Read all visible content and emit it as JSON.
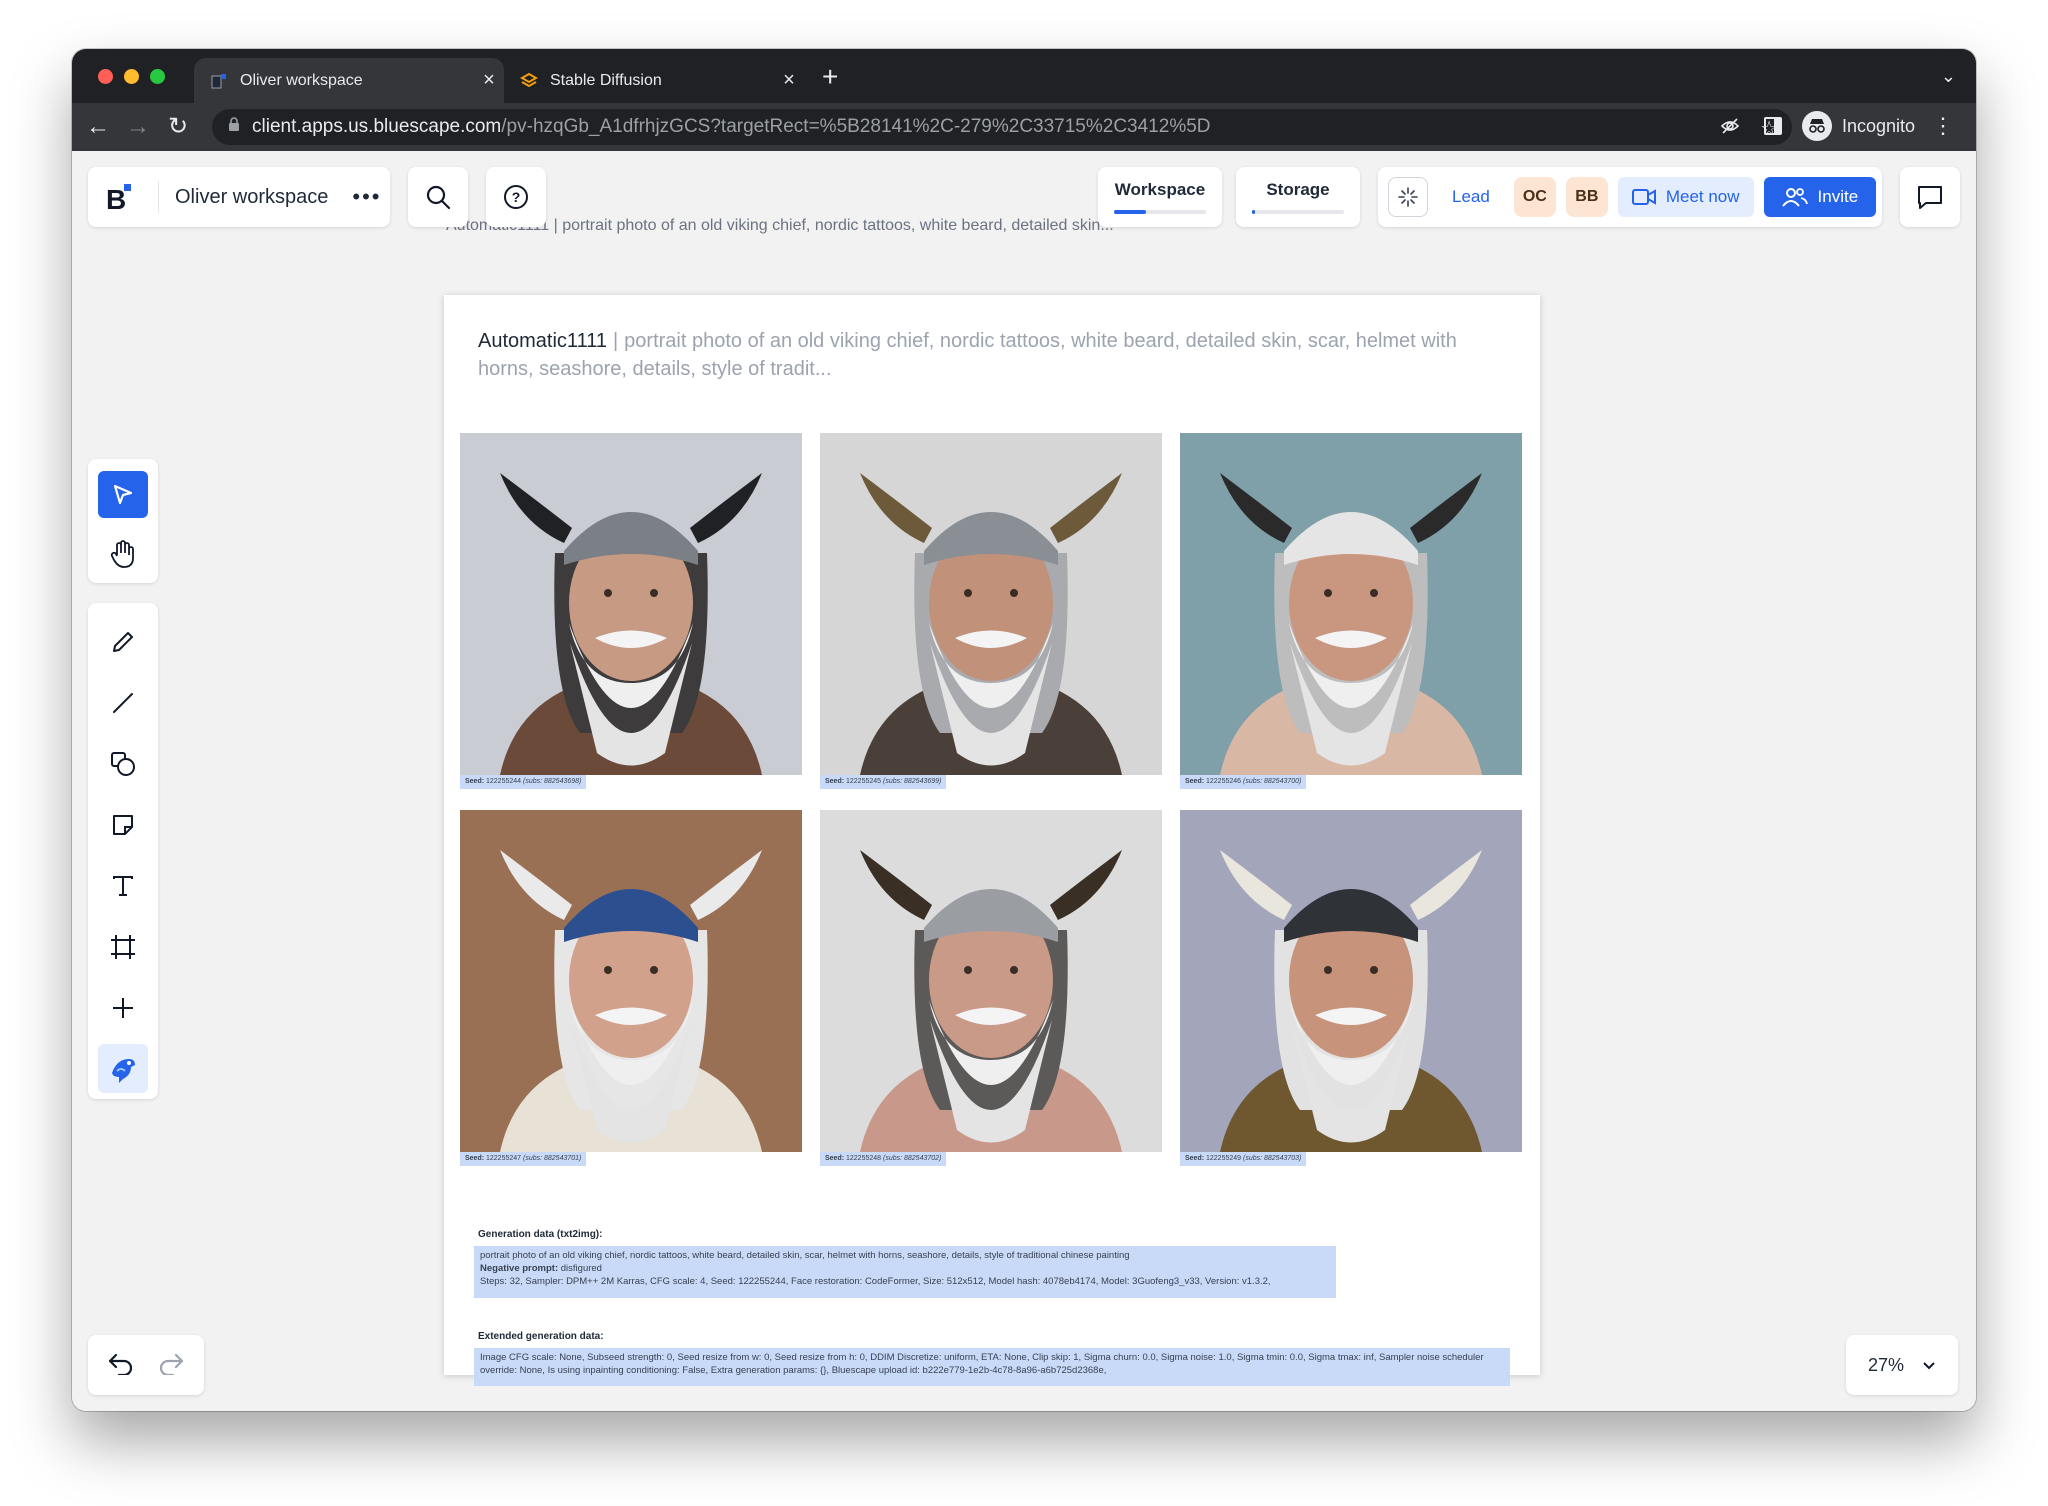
{
  "browser": {
    "tabs": [
      {
        "title": "Oliver workspace",
        "active": true,
        "icon": "bluescape-icon"
      },
      {
        "title": "Stable Diffusion",
        "active": false,
        "icon": "stable-diffusion-icon"
      }
    ],
    "url_host": "client.apps.us.bluescape.com",
    "url_path": "/pv-hzqGb_A1dfrhjzGCS?targetRect=%5B28141%2C-279%2C33715%2C3412%5D",
    "profile_label": "Incognito"
  },
  "app": {
    "workspace_name": "Oliver workspace",
    "more_label": "•••",
    "nav_tabs": [
      {
        "label": "Workspace",
        "progress": 0.35
      },
      {
        "label": "Storage",
        "progress": 0.03
      }
    ],
    "lead_label": "Lead",
    "avatars": [
      "OC",
      "BB"
    ],
    "meet_label": "Meet now",
    "invite_label": "Invite",
    "zoom_level": "27%"
  },
  "document": {
    "canvas_label": "Automatic1111 | portrait photo of an old viking chief, nordic tattoos, white beard, detailed skin...",
    "source": "Automatic1111",
    "separator": "|",
    "prompt_preview": "portrait photo of an old viking chief, nordic tattoos, white beard, detailed skin, scar, helmet with horns, seashore, details, style of tradit...",
    "images": [
      {
        "seed_label": "Seed:",
        "seed_value": "122255244",
        "subseed": "(subs: 882543698)",
        "palette": "gray-sky"
      },
      {
        "seed_label": "Seed:",
        "seed_value": "122255245",
        "subseed": "(subs: 882543699)",
        "palette": "studio-gray"
      },
      {
        "seed_label": "Seed:",
        "seed_value": "122255246",
        "subseed": "(subs: 882543700)",
        "palette": "teal-sea"
      },
      {
        "seed_label": "Seed:",
        "seed_value": "122255247",
        "subseed": "(subs: 882543701)",
        "palette": "brown-studio"
      },
      {
        "seed_label": "Seed:",
        "seed_value": "122255248",
        "subseed": "(subs: 882543702)",
        "palette": "light-gray"
      },
      {
        "seed_label": "Seed:",
        "seed_value": "122255249",
        "subseed": "(subs: 882543703)",
        "palette": "lavender"
      }
    ],
    "generation_title": "Generation data (txt2img):",
    "generation_prompt": "portrait photo of an old viking chief, nordic tattoos, white beard, detailed skin, scar, helmet with horns, seashore, details, style of traditional chinese painting",
    "negative_label": "Negative prompt:",
    "negative_value": "disfigured",
    "params_line": "Steps: 32, Sampler: DPM++ 2M Karras, CFG scale: 4, Seed: 122255244, Face restoration: CodeFormer, Size: 512x512, Model hash: 4078eb4174, Model: 3Guofeng3_v33, Version: v1.3.2,",
    "extended_title": "Extended generation data:",
    "extended_line": "Image CFG scale: None, Subseed strength: 0, Seed resize from w: 0, Seed resize from h: 0, DDIM Discretize: uniform, ETA: None, Clip skip: 1, Sigma churn: 0.0, Sigma noise: 1.0, Sigma tmin: 0.0, Sigma tmax: inf, Sampler noise scheduler override: None, Is using inpainting conditioning: False, Extra generation params: {}, Bluescape upload id: b222e779-1e2b-4c78-8a96-a6b725d2368e,"
  },
  "colors": {
    "accent": "#2563eb",
    "avatar_bg": "#fde5d3",
    "highlight": "#c9daf8"
  }
}
